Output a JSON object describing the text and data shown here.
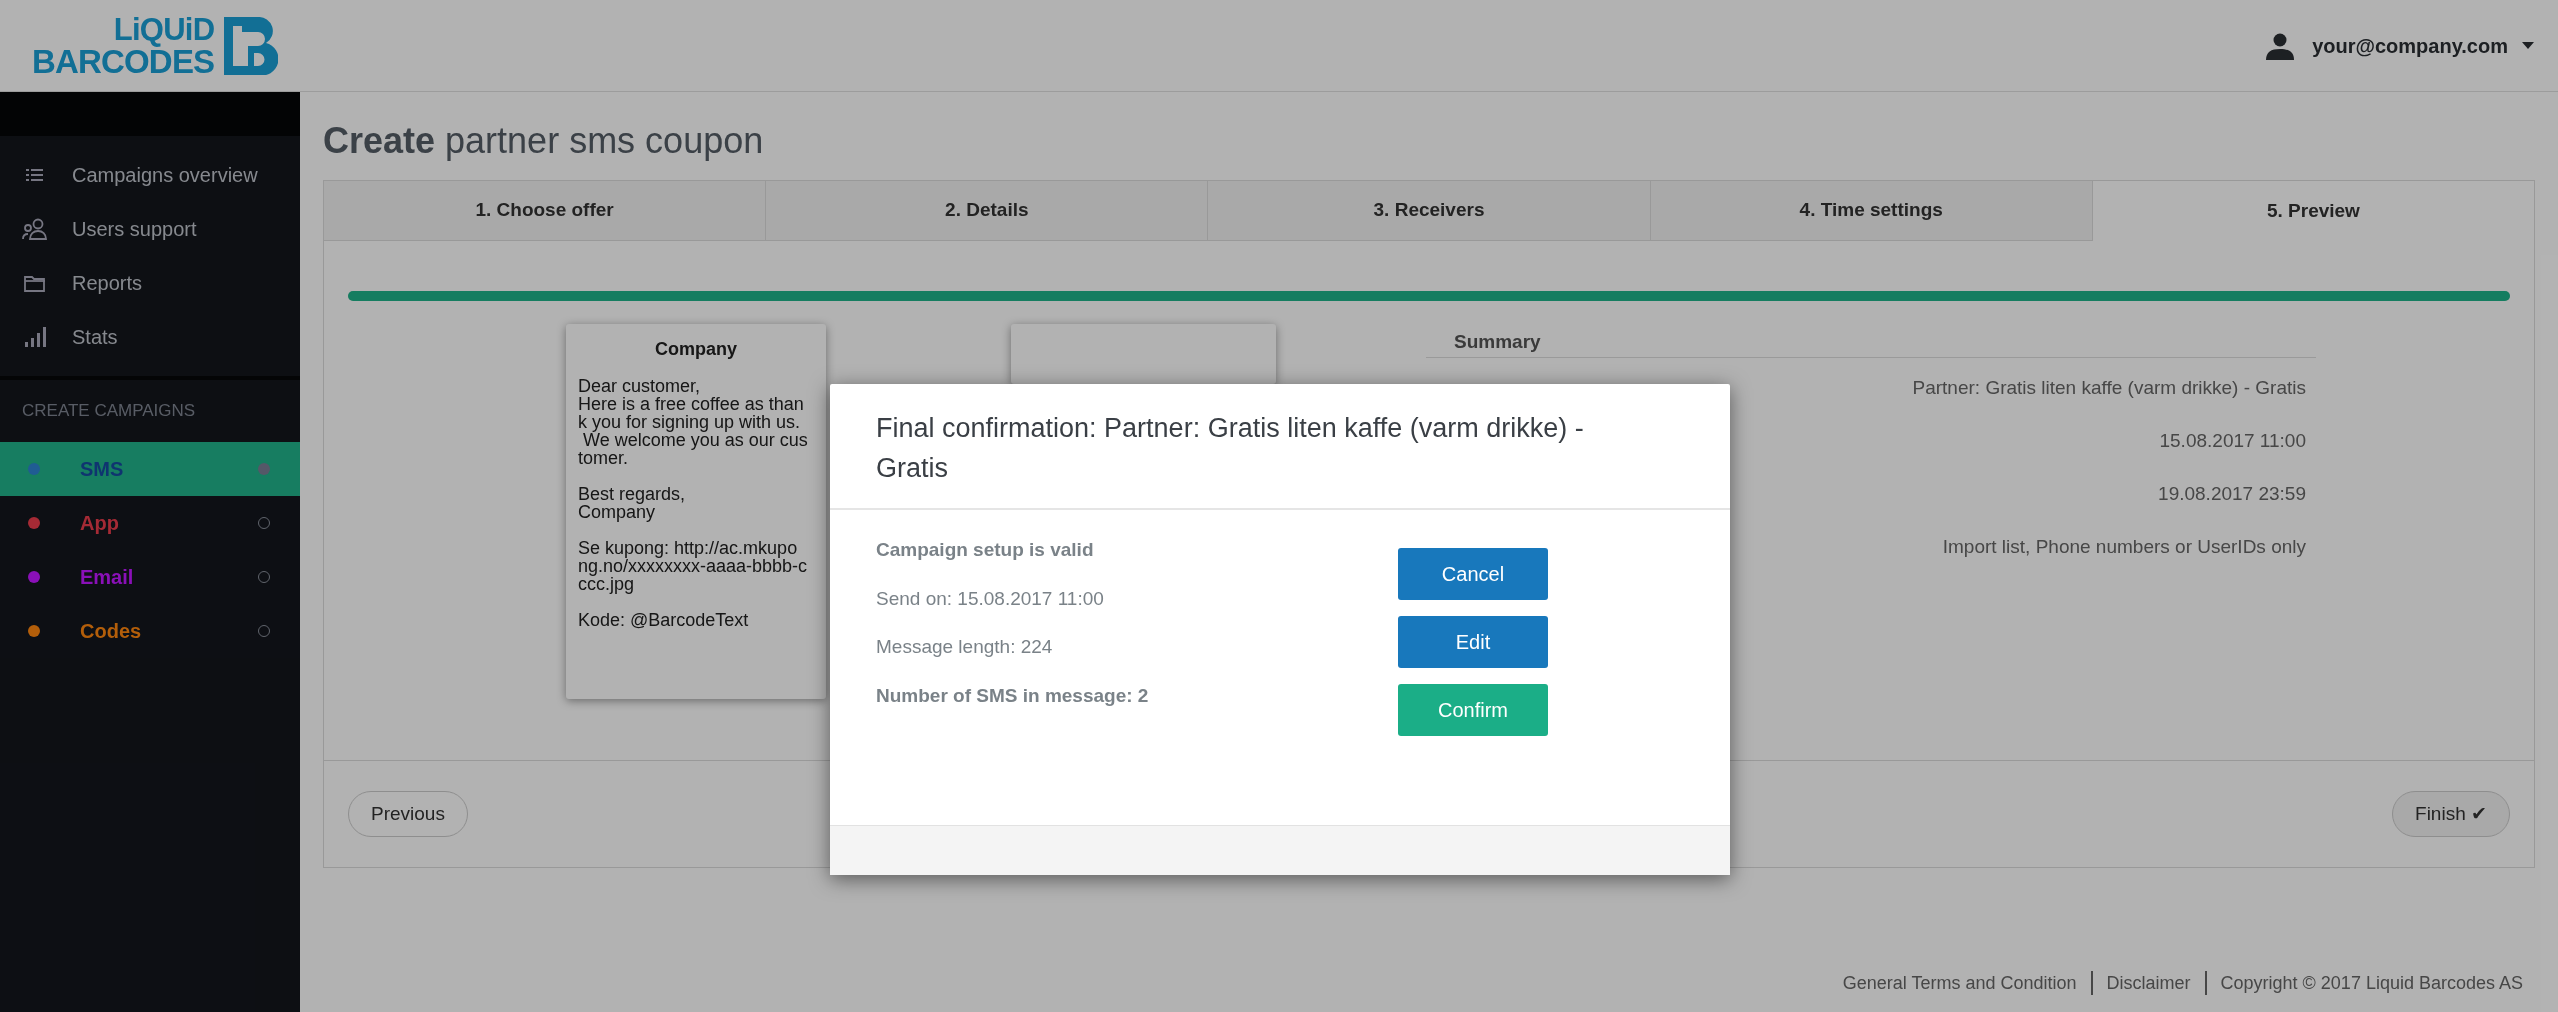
{
  "logo": {
    "line_1": "LiQUiD",
    "line_2": "BARCODES"
  },
  "user_menu": {
    "email": "your@company.com"
  },
  "sidebar": {
    "items": [
      {
        "label": "Campaigns overview"
      },
      {
        "label": "Users support"
      },
      {
        "label": "Reports"
      },
      {
        "label": "Stats"
      }
    ],
    "section_title": "CREATE CAMPAIGNS",
    "campaign_types": [
      {
        "label": "SMS",
        "color": "#205c93",
        "selected": true
      },
      {
        "label": "App",
        "color": "#a52a35",
        "selected": false
      },
      {
        "label": "Email",
        "color": "#8a10b8",
        "selected": false
      },
      {
        "label": "Codes",
        "color": "#b35e0a",
        "selected": false
      }
    ]
  },
  "page_title": {
    "bold": "Create",
    "rest": "partner sms coupon"
  },
  "wizard_tabs": [
    {
      "label": "1. Choose offer",
      "selected": false
    },
    {
      "label": "2. Details",
      "selected": false
    },
    {
      "label": "3. Receivers",
      "selected": false
    },
    {
      "label": "4. Time settings",
      "selected": false
    },
    {
      "label": "5. Preview",
      "selected": true
    }
  ],
  "progress": {
    "level": 1.0
  },
  "sms_preview": {
    "sender": "Company",
    "paragraphs": [
      [
        "Dear customer,",
        "Here is a free coffee as than",
        "k you for signing up with us.",
        " We welcome you as our cus",
        "tomer."
      ],
      [
        "Best regards,",
        "Company"
      ],
      [
        "Se kupong: http://ac.mkupo",
        "ng.no/xxxxxxxx-aaaa-bbbb-c",
        "ccc.jpg"
      ],
      [
        "Kode: @BarcodeText"
      ]
    ]
  },
  "summary": {
    "title": "Summary",
    "values": [
      "Partner: Gratis liten kaffe (varm drikke) - Gratis",
      "15.08.2017 11:00",
      "19.08.2017 23:59",
      "Import list, Phone numbers or UserIDs only"
    ]
  },
  "buttons": {
    "previous": "Previous",
    "finish": "Finish ✔"
  },
  "footer": [
    "General Terms and Condition",
    "Disclaimer",
    "Copyright © 2017 Liquid Barcodes AS"
  ],
  "modal": {
    "title": "Final confirmation: Partner: Gratis liten kaffe (varm drikke) - Gratis",
    "lines": [
      {
        "text": "Campaign setup is valid",
        "bold": true
      },
      {
        "text": "Send on: 15.08.2017 11:00",
        "bold": false
      },
      {
        "text": "Message length: 224",
        "bold": false
      },
      {
        "text": "Number of SMS in message: 2",
        "bold": true
      }
    ],
    "buttons": [
      {
        "label": "Cancel",
        "kind": "primary"
      },
      {
        "label": "Edit",
        "kind": "primary"
      },
      {
        "label": "Confirm",
        "kind": "success"
      }
    ]
  }
}
